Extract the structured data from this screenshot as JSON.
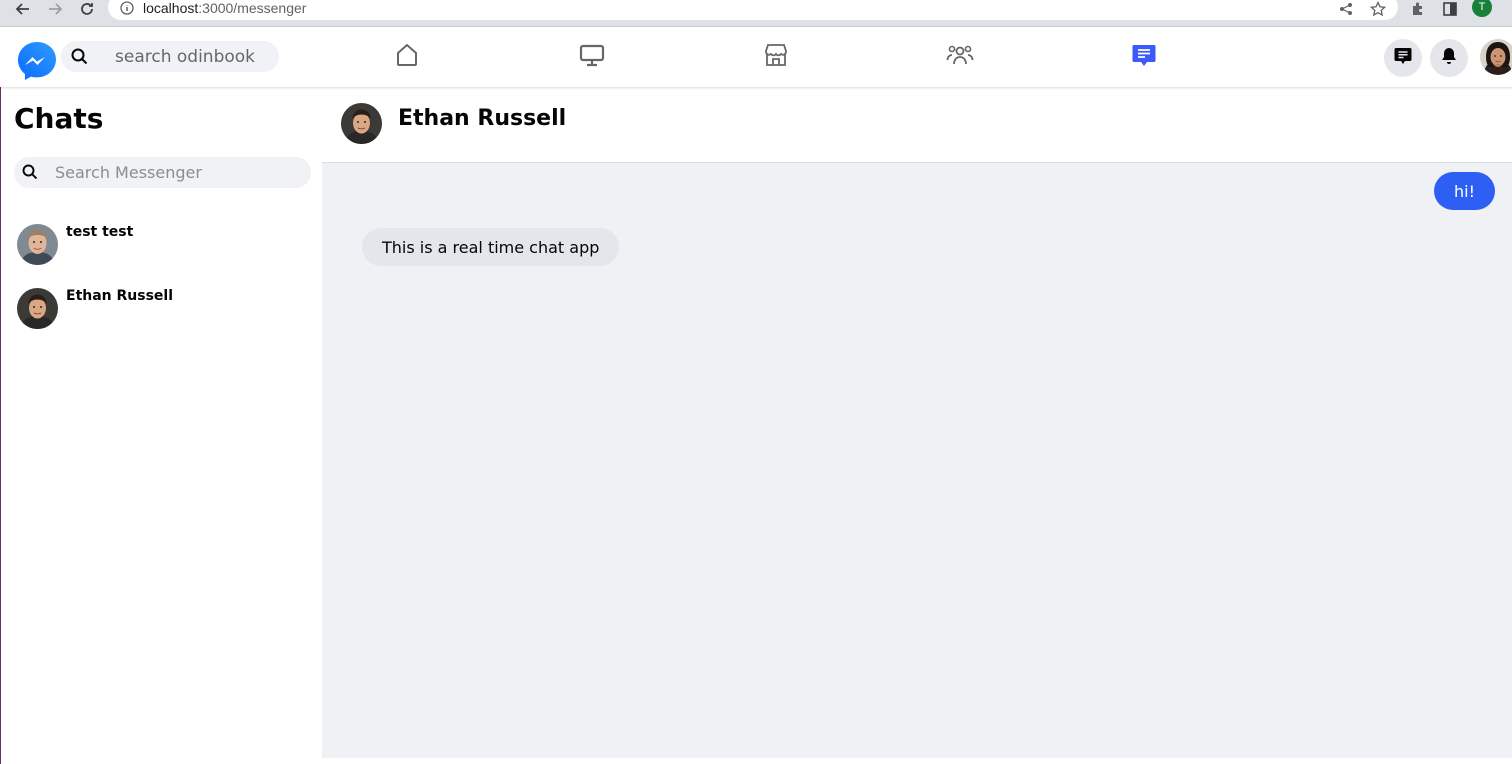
{
  "browser": {
    "url_host": "localhost",
    "url_path": ":3000/messenger",
    "profile_initial": "T"
  },
  "header": {
    "search_placeholder": "search odinbook",
    "nav": [
      {
        "name": "home-icon",
        "active": false
      },
      {
        "name": "watch-icon",
        "active": false
      },
      {
        "name": "marketplace-icon",
        "active": false
      },
      {
        "name": "groups-icon",
        "active": false
      },
      {
        "name": "messenger-icon",
        "active": true
      }
    ],
    "accent_color": "#3d5afe"
  },
  "sidebar": {
    "title": "Chats",
    "search_placeholder": "Search Messenger",
    "chats": [
      {
        "name": "test test"
      },
      {
        "name": "Ethan Russell"
      }
    ]
  },
  "conversation": {
    "contact_name": "Ethan Russell",
    "messages": [
      {
        "direction": "outgoing",
        "text": "hi!"
      },
      {
        "direction": "incoming",
        "text": "This is a real time chat app"
      }
    ]
  },
  "colors": {
    "outgoing_bubble": "#2d5ff5",
    "incoming_bubble": "#e4e6eb",
    "chat_background": "#f0f1f5"
  }
}
